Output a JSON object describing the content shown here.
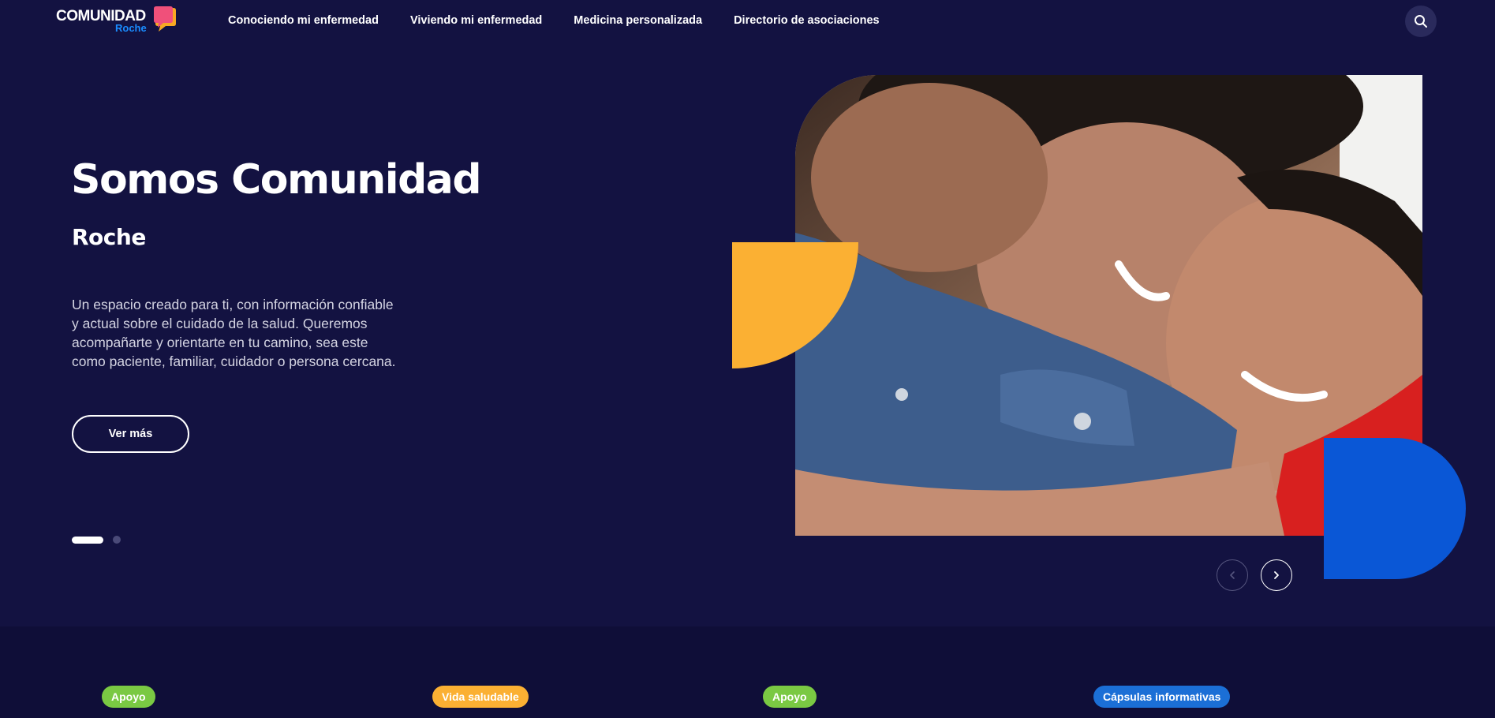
{
  "header": {
    "logo_text": "COMUNIDAD",
    "logo_sub": "Roche",
    "nav": [
      "Conociendo mi enfermedad",
      "Viviendo mi enfermedad",
      "Medicina personalizada",
      "Directorio de asociaciones"
    ],
    "search_icon": "search-icon"
  },
  "hero": {
    "title": "Somos Comunidad",
    "subtitle": "Roche",
    "description": "Un espacio creado para ti, con información confiable y actual sobre el cuidado de la salud. Queremos acompañarte y orientarte en tu camino, sea este como paciente, familiar, cuidador o persona cercana.",
    "cta": "Ver más",
    "carousel_total_slides": 2,
    "carousel_active_slide": 1
  },
  "colors": {
    "background": "#131241",
    "accent_yellow": "#fbb033",
    "accent_blue": "#0a57d6",
    "tag_green": "#7ac943",
    "tag_blue": "#1b6fd6"
  },
  "tags": [
    "Apoyo",
    "Vida saludable",
    "Apoyo",
    "Cápsulas informativas"
  ]
}
